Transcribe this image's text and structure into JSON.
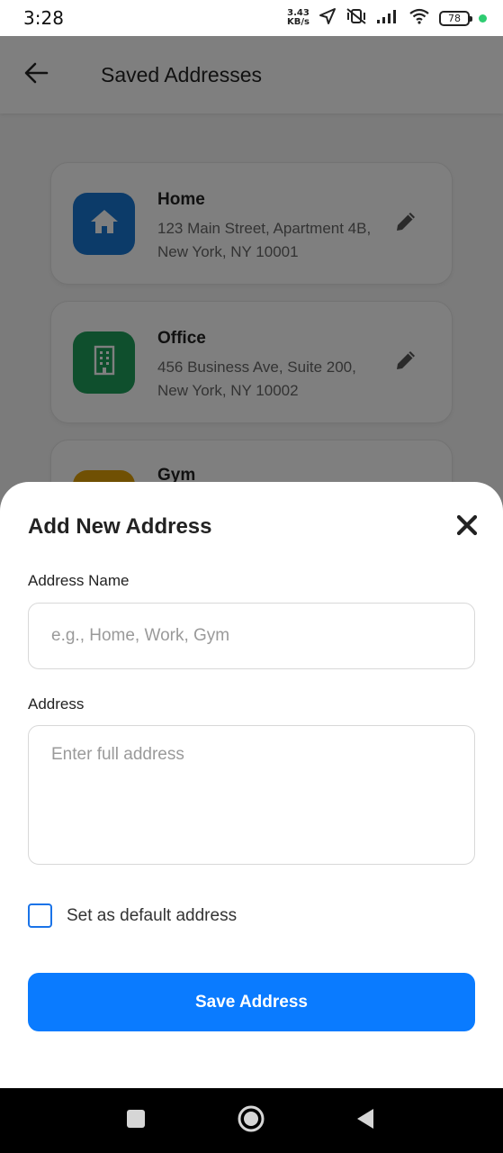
{
  "status_bar": {
    "time": "3:28",
    "speed_value": "3.43",
    "speed_unit": "KB/s",
    "battery": "78"
  },
  "app_bar": {
    "title": "Saved Addresses"
  },
  "addresses": [
    {
      "name": "Home",
      "address": "123 Main Street, Apartment 4B, New York, NY 10001",
      "icon": "home-icon",
      "color": "#1976d2"
    },
    {
      "name": "Office",
      "address": "456 Business Ave, Suite 200, New York, NY 10002",
      "icon": "building-icon",
      "color": "#1e9e5a"
    },
    {
      "name": "Gym",
      "address": "",
      "icon": "gym-icon",
      "color": "#e0a106"
    }
  ],
  "sheet": {
    "title": "Add New Address",
    "name_label": "Address Name",
    "name_placeholder": "e.g., Home, Work, Gym",
    "address_label": "Address",
    "address_placeholder": "Enter full address",
    "default_label": "Set as default address",
    "save_label": "Save Address"
  },
  "colors": {
    "primary": "#0a7bff",
    "checkbox_border": "#1a73e8"
  }
}
